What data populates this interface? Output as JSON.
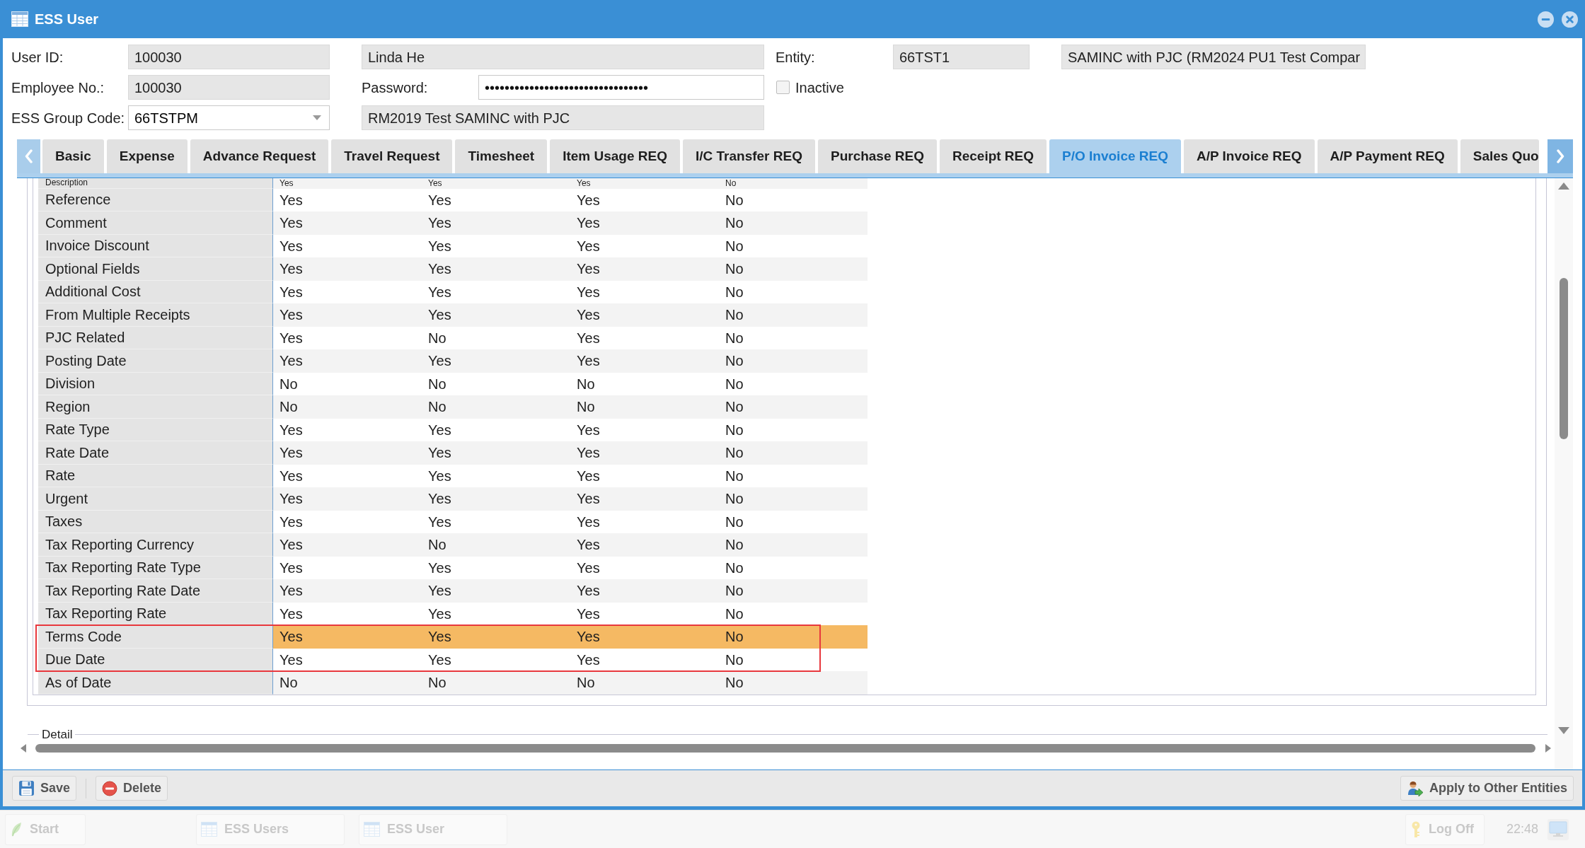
{
  "window": {
    "title": "ESS User"
  },
  "form": {
    "user_id": {
      "label": "User ID:",
      "value": "100030",
      "readonly": true
    },
    "user_name": {
      "value": "Linda He",
      "readonly": true
    },
    "entity": {
      "label": "Entity:",
      "value": "66TST1",
      "readonly": true
    },
    "entity_name": {
      "value": "SAMINC with PJC (RM2024 PU1 Test Compar",
      "readonly": true
    },
    "employee_no": {
      "label": "Employee No.:",
      "value": "100030",
      "readonly": true
    },
    "password": {
      "label": "Password:",
      "value": "•••••••••••••••••••••••••••••••••",
      "readonly": false
    },
    "inactive": {
      "label": "Inactive",
      "checked": false
    },
    "ess_group_code": {
      "label": "ESS Group Code:",
      "value": "66TSTPM",
      "readonly": false
    },
    "group_description": {
      "value": "RM2019 Test SAMINC with PJC",
      "readonly": true
    }
  },
  "tabs": [
    {
      "label": "Basic",
      "selected": false
    },
    {
      "label": "Expense",
      "selected": false
    },
    {
      "label": "Advance Request",
      "selected": false
    },
    {
      "label": "Travel Request",
      "selected": false
    },
    {
      "label": "Timesheet",
      "selected": false
    },
    {
      "label": "Item Usage REQ",
      "selected": false
    },
    {
      "label": "I/C Transfer REQ",
      "selected": false
    },
    {
      "label": "Purchase REQ",
      "selected": false
    },
    {
      "label": "Receipt REQ",
      "selected": false
    },
    {
      "label": "P/O Invoice REQ",
      "selected": true
    },
    {
      "label": "A/P Invoice REQ",
      "selected": false
    },
    {
      "label": "A/P Payment REQ",
      "selected": false
    },
    {
      "label": "Sales Quo",
      "selected": false
    }
  ],
  "table": {
    "rows": [
      {
        "label": "Description",
        "values": [
          "Yes",
          "Yes",
          "Yes",
          "No"
        ],
        "selected": false,
        "outlined": false
      },
      {
        "label": "Reference",
        "values": [
          "Yes",
          "Yes",
          "Yes",
          "No"
        ],
        "selected": false,
        "outlined": false
      },
      {
        "label": "Comment",
        "values": [
          "Yes",
          "Yes",
          "Yes",
          "No"
        ],
        "selected": false,
        "outlined": false
      },
      {
        "label": "Invoice Discount",
        "values": [
          "Yes",
          "Yes",
          "Yes",
          "No"
        ],
        "selected": false,
        "outlined": false
      },
      {
        "label": "Optional Fields",
        "values": [
          "Yes",
          "Yes",
          "Yes",
          "No"
        ],
        "selected": false,
        "outlined": false
      },
      {
        "label": "Additional Cost",
        "values": [
          "Yes",
          "Yes",
          "Yes",
          "No"
        ],
        "selected": false,
        "outlined": false
      },
      {
        "label": "From Multiple Receipts",
        "values": [
          "Yes",
          "Yes",
          "Yes",
          "No"
        ],
        "selected": false,
        "outlined": false
      },
      {
        "label": "PJC Related",
        "values": [
          "Yes",
          "No",
          "Yes",
          "No"
        ],
        "selected": false,
        "outlined": false
      },
      {
        "label": "Posting Date",
        "values": [
          "Yes",
          "Yes",
          "Yes",
          "No"
        ],
        "selected": false,
        "outlined": false
      },
      {
        "label": "Division",
        "values": [
          "No",
          "No",
          "No",
          "No"
        ],
        "selected": false,
        "outlined": false
      },
      {
        "label": "Region",
        "values": [
          "No",
          "No",
          "No",
          "No"
        ],
        "selected": false,
        "outlined": false
      },
      {
        "label": "Rate Type",
        "values": [
          "Yes",
          "Yes",
          "Yes",
          "No"
        ],
        "selected": false,
        "outlined": false
      },
      {
        "label": "Rate Date",
        "values": [
          "Yes",
          "Yes",
          "Yes",
          "No"
        ],
        "selected": false,
        "outlined": false
      },
      {
        "label": "Rate",
        "values": [
          "Yes",
          "Yes",
          "Yes",
          "No"
        ],
        "selected": false,
        "outlined": false
      },
      {
        "label": "Urgent",
        "values": [
          "Yes",
          "Yes",
          "Yes",
          "No"
        ],
        "selected": false,
        "outlined": false
      },
      {
        "label": "Taxes",
        "values": [
          "Yes",
          "Yes",
          "Yes",
          "No"
        ],
        "selected": false,
        "outlined": false
      },
      {
        "label": "Tax Reporting Currency",
        "values": [
          "Yes",
          "No",
          "Yes",
          "No"
        ],
        "selected": false,
        "outlined": false
      },
      {
        "label": "Tax Reporting Rate Type",
        "values": [
          "Yes",
          "Yes",
          "Yes",
          "No"
        ],
        "selected": false,
        "outlined": false
      },
      {
        "label": "Tax Reporting Rate Date",
        "values": [
          "Yes",
          "Yes",
          "Yes",
          "No"
        ],
        "selected": false,
        "outlined": false
      },
      {
        "label": "Tax Reporting Rate",
        "values": [
          "Yes",
          "Yes",
          "Yes",
          "No"
        ],
        "selected": false,
        "outlined": false
      },
      {
        "label": "Terms Code",
        "values": [
          "Yes",
          "Yes",
          "Yes",
          "No"
        ],
        "selected": true,
        "outlined": true
      },
      {
        "label": "Due Date",
        "values": [
          "Yes",
          "Yes",
          "Yes",
          "No"
        ],
        "selected": false,
        "outlined": true
      },
      {
        "label": "As of Date",
        "values": [
          "No",
          "No",
          "No",
          "No"
        ],
        "selected": false,
        "outlined": false
      }
    ]
  },
  "detail": {
    "legend": "Detail"
  },
  "toolbar": {
    "left_buttons": [
      {
        "kind": "save",
        "label": "Save"
      },
      {
        "kind": "delete",
        "label": "Delete"
      }
    ],
    "right_buttons": [
      {
        "kind": "apply",
        "label": "Apply to Other Entities"
      }
    ]
  },
  "taskbar": {
    "items": [
      {
        "kind": "start",
        "label": "Start"
      },
      {
        "kind": "window",
        "label": "ESS Users"
      },
      {
        "kind": "window",
        "label": "ESS User"
      }
    ],
    "log_off": {
      "label": "Log Off"
    },
    "clock": "22:48"
  }
}
